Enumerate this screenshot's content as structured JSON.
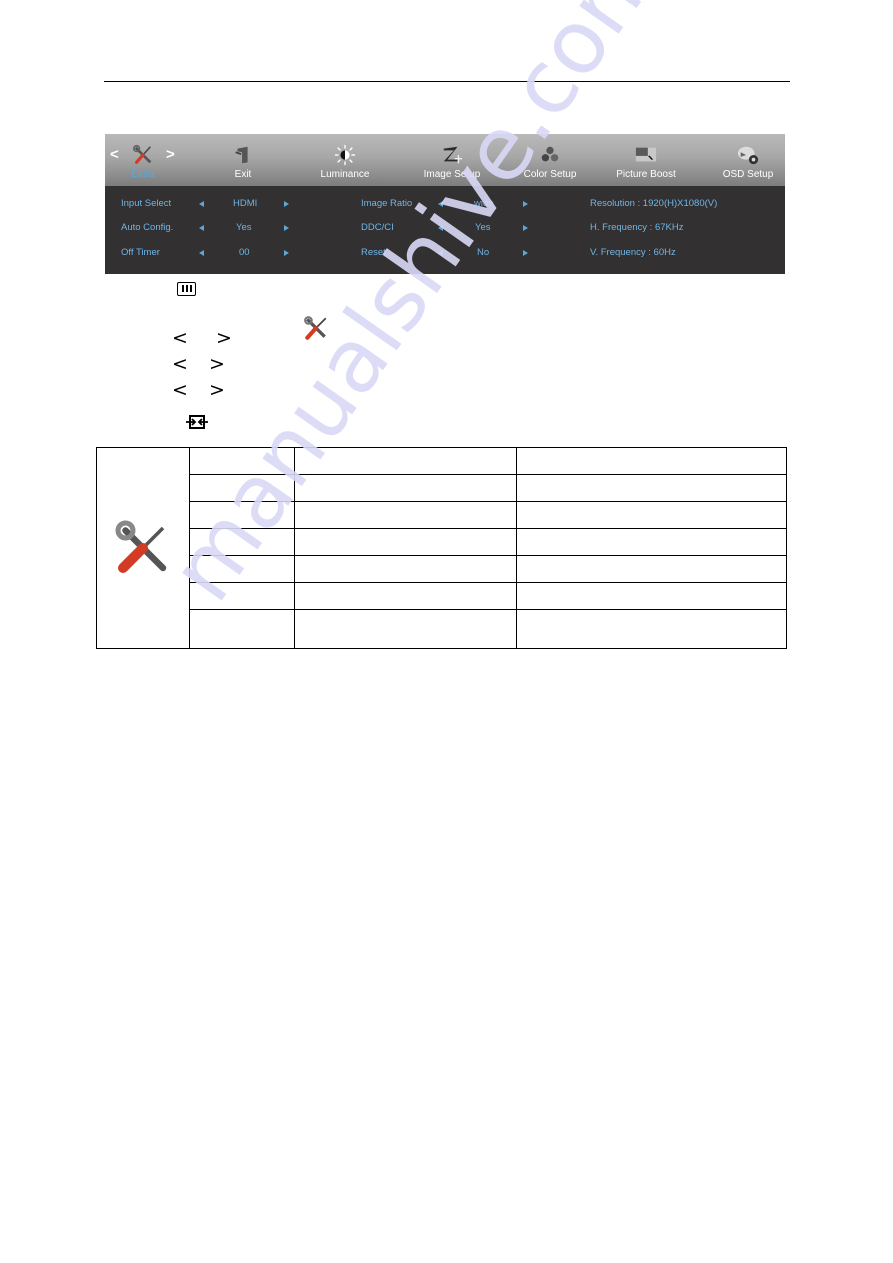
{
  "osd": {
    "tabs": [
      {
        "label": "Extra",
        "icon": "tools-icon",
        "active": true
      },
      {
        "label": "Exit",
        "icon": "exit-icon",
        "active": false
      },
      {
        "label": "Luminance",
        "icon": "sun-icon",
        "active": false
      },
      {
        "label": "Image Setup",
        "icon": "image-setup-icon",
        "active": false
      },
      {
        "label": "Color Setup",
        "icon": "color-dots-icon",
        "active": false
      },
      {
        "label": "Picture Boost",
        "icon": "picture-boost-icon",
        "active": false
      },
      {
        "label": "OSD Setup",
        "icon": "osd-setup-icon",
        "active": false
      }
    ],
    "nav_prev": "<",
    "nav_next": ">",
    "settings_left": [
      {
        "label": "Input Select",
        "value": "HDMI"
      },
      {
        "label": "Auto Config.",
        "value": "Yes"
      },
      {
        "label": "Off Timer",
        "value": "00"
      }
    ],
    "settings_mid": [
      {
        "label": "Image Ratio",
        "value": "wide"
      },
      {
        "label": "DDC/CI",
        "value": "Yes"
      },
      {
        "label": "Reset",
        "value": "No"
      }
    ],
    "info": [
      "Resolution : 1920(H)X1080(V)",
      "H. Frequency : 67KHz",
      "V. Frequency : 60Hz"
    ],
    "colors": {
      "accent": "#5aa8d8",
      "body_bg": "#323030"
    }
  },
  "instructions": {
    "chevron_left": "<",
    "chevron_right": ">"
  },
  "table": {
    "rows": [
      [
        "",
        ""
      ],
      [
        "",
        ""
      ],
      [
        "",
        ""
      ],
      [
        "",
        ""
      ],
      [
        "",
        ""
      ],
      [
        "",
        ""
      ],
      [
        "",
        ""
      ]
    ]
  },
  "watermark": "manualshive.com"
}
